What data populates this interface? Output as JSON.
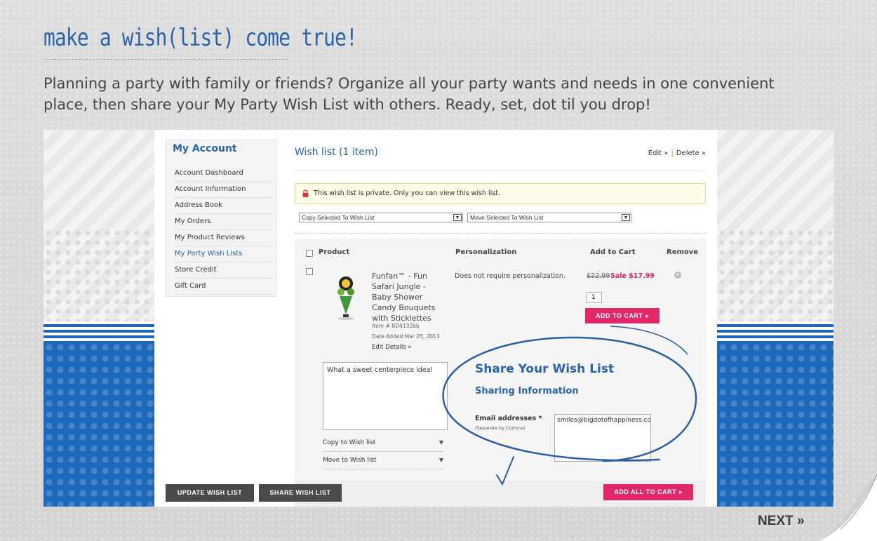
{
  "header": {
    "title": "make a wish(list) come true!",
    "intro": "Planning a party with family or friends? Organize all your party wants and needs in one convenient place, then share your My Party Wish List with others. Ready, set, dot til you drop!"
  },
  "sidebar": {
    "title": "My Account",
    "items": [
      {
        "label": "Account Dashboard"
      },
      {
        "label": "Account Information"
      },
      {
        "label": "Address Book"
      },
      {
        "label": "My Orders"
      },
      {
        "label": "My Product Reviews"
      },
      {
        "label": "My Party Wish Lists"
      },
      {
        "label": "Store Credit"
      },
      {
        "label": "Gift Card"
      }
    ],
    "active_index": 5
  },
  "wishlist": {
    "title": "Wish list (1 item)",
    "edit_link": "Edit »",
    "delete_link": "Delete »",
    "privacy_notice": "This wish list is private. Only you can view this wish list.",
    "copy_select": "Copy Selected To Wish List",
    "move_select": "Move Selected To Wish List",
    "columns": {
      "product": "Product",
      "personalization": "Personalization",
      "add_to_cart": "Add to Cart",
      "remove": "Remove"
    },
    "item": {
      "name": "Funfan™ - Fun Safari Jungle - Baby Shower Candy Bouquets with Sticklettes",
      "item_no": "Item # BD4132bb",
      "date_added": "Date Added:Mar 25, 2013",
      "edit_details": "Edit Details »",
      "personalization": "Does not require personalization.",
      "old_price": "$22.99",
      "sale_price": "Sale $17.99",
      "qty": "1",
      "add_to_cart": "ADD TO CART",
      "comment": "What a sweet centerpiece idea!",
      "copy_to": "Copy to Wish list",
      "move_to": "Move to Wish list"
    },
    "buttons": {
      "update": "UPDATE WISH LIST",
      "share": "SHARE WISH LIST",
      "add_all": "ADD ALL TO CART"
    }
  },
  "share": {
    "title": "Share Your Wish List",
    "subtitle": "Sharing Information",
    "email_label": "Email addresses *",
    "email_hint": "(Separate by Comma)",
    "email_value": "smiles@bigdotofhappiness.com"
  },
  "nav": {
    "next": "NEXT »"
  },
  "colors": {
    "brand_blue": "#2a63a8",
    "accent_pink": "#e0286b",
    "band_blue": "#1e68bc"
  }
}
